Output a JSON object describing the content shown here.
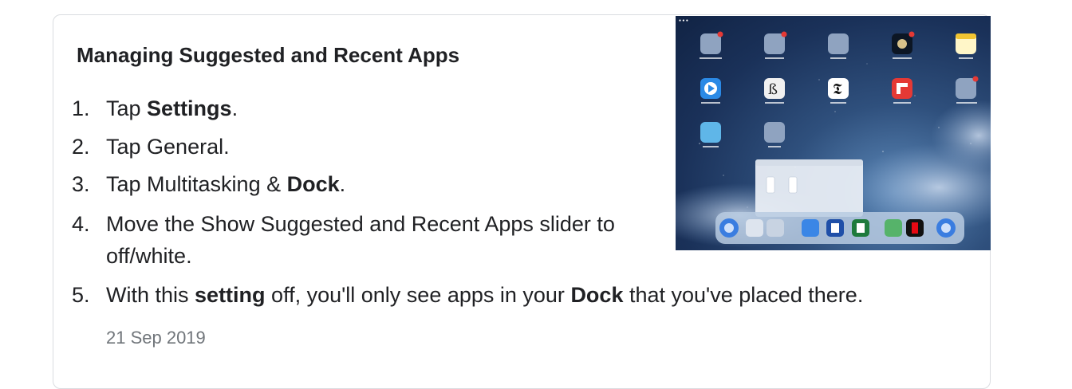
{
  "title": "Managing Suggested and Recent Apps",
  "steps": [
    {
      "num": "1.",
      "parts": [
        "Tap ",
        "Settings",
        "."
      ]
    },
    {
      "num": "2.",
      "parts": [
        "Tap General."
      ]
    },
    {
      "num": "3.",
      "parts": [
        "Tap Multitasking & ",
        "Dock",
        "."
      ]
    },
    {
      "num": "4.",
      "parts": [
        "Move the Show Suggested and Recent Apps slider to off/white."
      ]
    },
    {
      "num": "5.",
      "parts": [
        "With this ",
        "setting",
        " off, you'll only see apps in your ",
        "Dock",
        " that you've placed there."
      ]
    }
  ],
  "date": "21 Sep 2019",
  "thumbnail": {
    "subject": "iPad home screen with dock",
    "colors": {
      "sky": "#1a3159",
      "dock": "#9fb6d4"
    }
  }
}
